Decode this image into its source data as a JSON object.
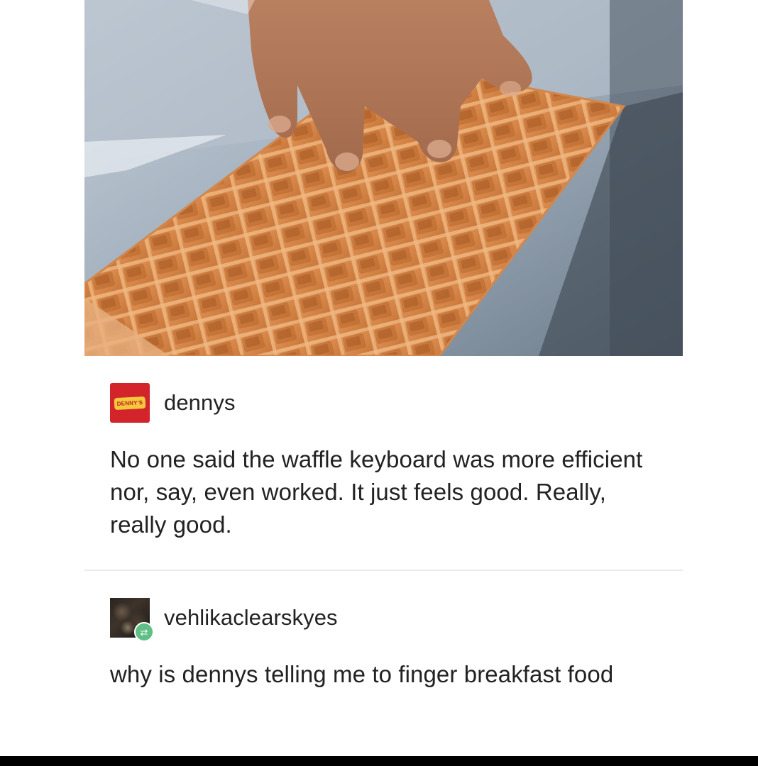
{
  "post1": {
    "username": "dennys",
    "avatar_logo_text": "DENNY'S",
    "body": "No one said the waffle keyboard was more efficient nor, say, even worked. It just feels good. Really, really good."
  },
  "post2": {
    "username": "vehlikaclearskyes",
    "reblog_icon": "reblog-icon",
    "body": "why is dennys telling me to finger breakfast food"
  },
  "colors": {
    "dennys_red": "#d3232b",
    "dennys_yellow": "#f3c83a",
    "reblog_green": "#5fbf86",
    "text": "#222222"
  }
}
